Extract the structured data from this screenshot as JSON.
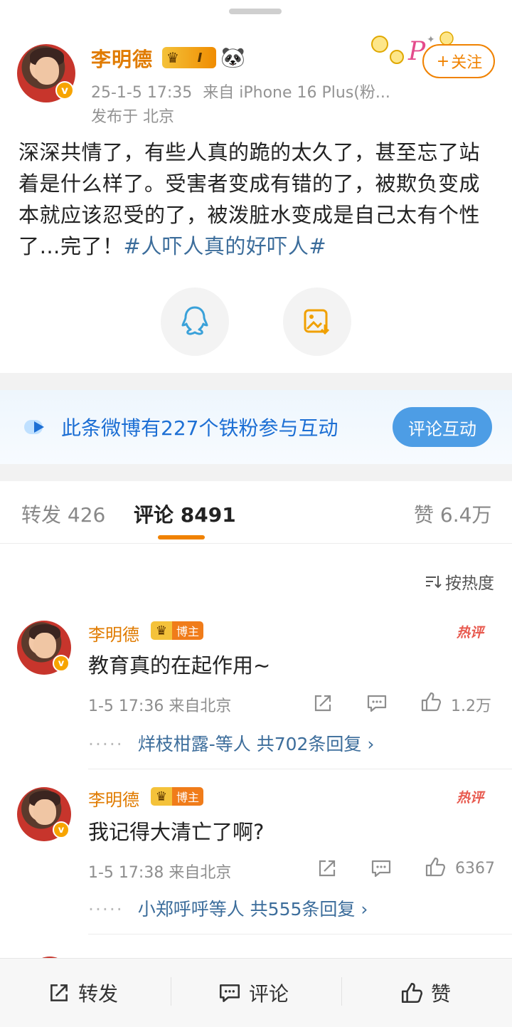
{
  "post": {
    "author": "李明德",
    "level": "I",
    "follow_label": "关注",
    "date": "25-1-5 17:35",
    "source": "来自 iPhone 16 Plus(粉...",
    "location": "发布于 北京",
    "text": "深深共情了，有些人真的跪的太久了，甚至忘了站着是什么样了。受害者变成有错的了，被欺负变成本就应该忍受的了，被泼脏水变成是自己太有个性了…完了！",
    "hashtag": "#人吓人真的好吓人#"
  },
  "fan_banner": {
    "text": "此条微博有227个铁粉参与互动",
    "button": "评论互动"
  },
  "tabs": {
    "repost": "转发 426",
    "comments": "评论 8491",
    "likes": "赞 6.4万"
  },
  "sort_label": "按热度",
  "comments": [
    {
      "name": "李明德",
      "badge": "博主",
      "hot": "热评",
      "text": "教育真的在起作用~",
      "meta": "1-5 17:36 来自北京",
      "likes": "1.2万",
      "reply": "烊枝柑露-等人 共702条回复 ›"
    },
    {
      "name": "李明德",
      "badge": "博主",
      "hot": "热评",
      "text": "我记得大清亡了啊?",
      "meta": "1-5 17:38 来自北京",
      "likes": "6367",
      "reply": "小郑呼呼等人 共555条回复 ›"
    }
  ],
  "bottom_bar": {
    "repost": "转发",
    "comment": "评论",
    "like": "赞"
  },
  "colors": {
    "accent": "#f08200",
    "link": "#3c6d9b",
    "fan_blue": "#1d6fd4",
    "hot_red": "#e85a4f"
  },
  "icons": [
    "crown-icon",
    "panda-icon",
    "plus-icon",
    "qq-share-icon",
    "save-image-icon",
    "fan-icon",
    "sort-icon",
    "share-icon",
    "comment-icon",
    "like-icon"
  ]
}
